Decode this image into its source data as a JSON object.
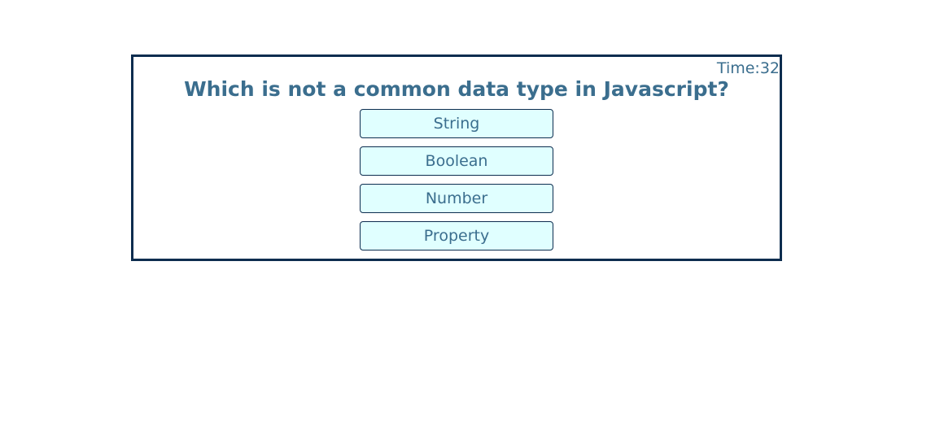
{
  "quiz": {
    "timer": "Time:32",
    "question": "Which is not a common data type in Javascript?",
    "answers": [
      "String",
      "Boolean",
      "Number",
      "Property"
    ]
  }
}
